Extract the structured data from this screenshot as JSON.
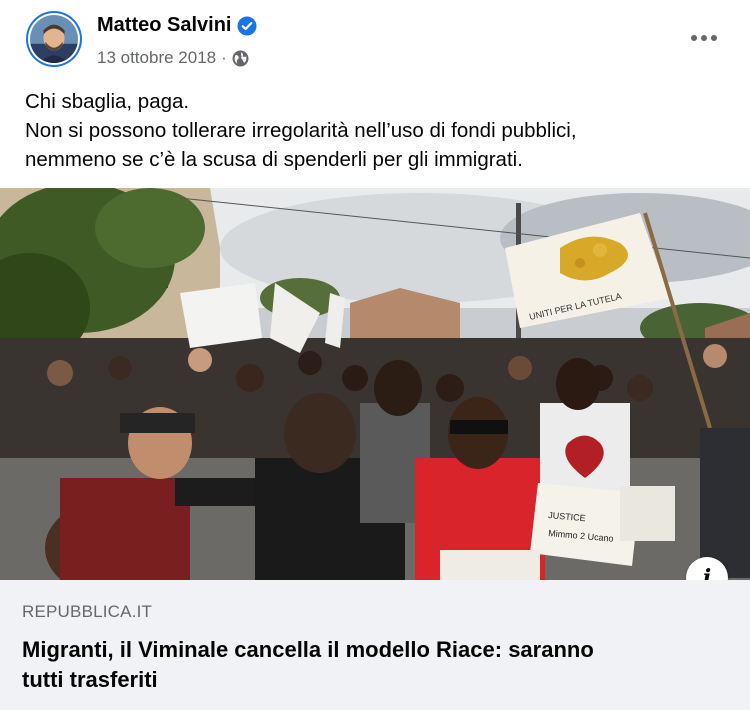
{
  "post": {
    "author": "Matteo Salvini",
    "date": "13 ottobre 2018",
    "separator": "·",
    "icons": {
      "verified": "verified-badge-icon",
      "privacy": "globe-icon",
      "more": "more-options-icon",
      "info": "info-icon"
    },
    "text_lines": [
      "Chi sbaglia, paga.",
      "Non si possono tollerare irregolarità nell’uso di fondi pubblici,",
      "nemmeno se c’è la scusa di spenderli per gli immigrati."
    ]
  },
  "photo": {
    "description_icon": "news-photo",
    "info_label": "i",
    "banner_text": "UNITI PER LA TUTELA",
    "sign_lines": [
      "Mimmo 2 Ucano",
      "JUSTICE"
    ]
  },
  "link": {
    "domain": "REPUBBLICA.IT",
    "title_lines": [
      "Migranti, il Viminale cancella il modello Riace: saranno",
      "tutti trasferiti"
    ]
  },
  "colors": {
    "accent": "#1b74e4",
    "meta": "#65676b",
    "card_bg": "#f0f2f5",
    "text": "#050505"
  }
}
